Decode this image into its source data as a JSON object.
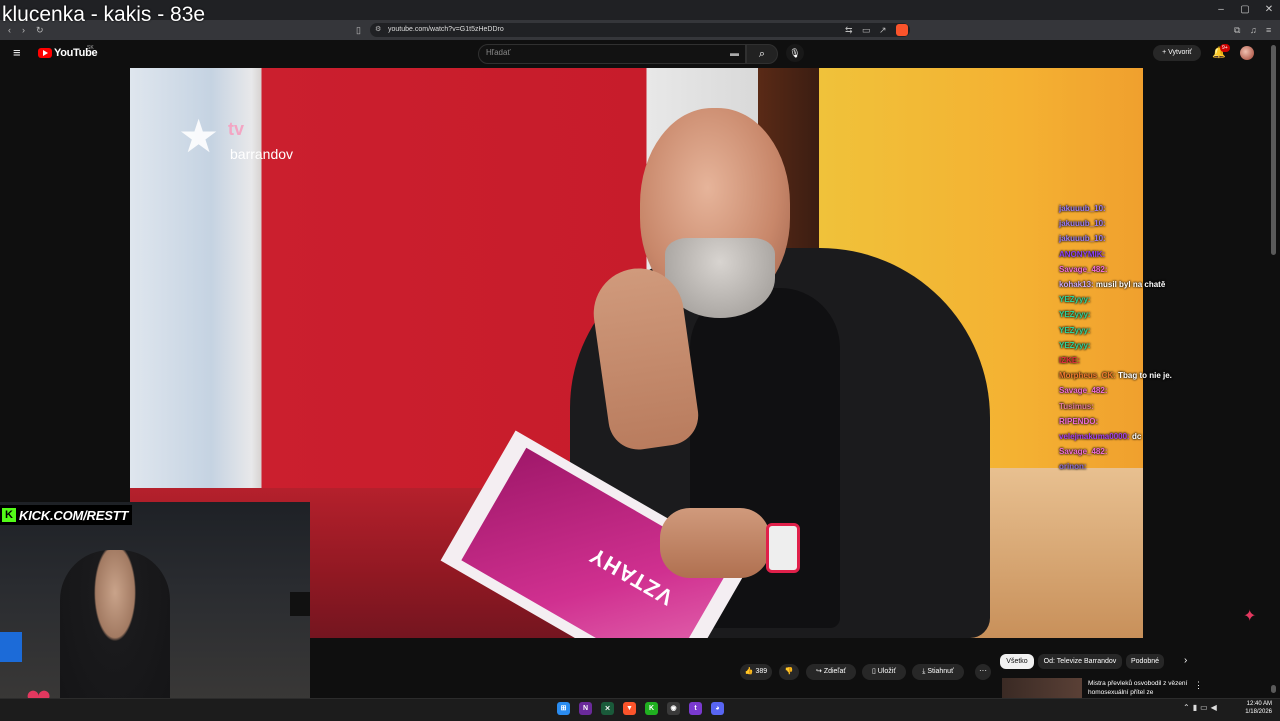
{
  "stream_overlay_title": "klucenka - kakis - 83e",
  "browser": {
    "url": "youtube.com/watch?v=G1t5zHeDDro",
    "window_controls": [
      "–",
      "▢",
      "✕"
    ]
  },
  "youtube_header": {
    "logo_text": "YouTube",
    "region": "SK",
    "search_placeholder": "Hľadať",
    "create_label": "Vytvoriť",
    "notification_count": "9+"
  },
  "video": {
    "channel_logo_tv": "tv",
    "channel_logo_name": "barrandov",
    "card_text": "VZTAHY"
  },
  "chat": [
    {
      "user": "jakuuub_10:",
      "msg": "",
      "color": "#9a7cf0"
    },
    {
      "user": "jakuuub_10:",
      "msg": "",
      "color": "#9a7cf0"
    },
    {
      "user": "jakuuub_10:",
      "msg": "",
      "color": "#9a7cf0"
    },
    {
      "user": "ANONYMIK:",
      "msg": "",
      "color": "#8a3ff0"
    },
    {
      "user": "Savage_482:",
      "msg": "",
      "color": "#f06cd8"
    },
    {
      "user": "kohak13:",
      "msg": "musil byl na chatě",
      "color": "#c9a7f5"
    },
    {
      "user": "YEZyyy:",
      "msg": "",
      "color": "#2fd39a"
    },
    {
      "user": "YEZyyy:",
      "msg": "",
      "color": "#2fd39a"
    },
    {
      "user": "YEZyyy:",
      "msg": "",
      "color": "#2fd39a"
    },
    {
      "user": "YEZyyy:",
      "msg": "",
      "color": "#2fd39a"
    },
    {
      "user": "IZKE:",
      "msg": "",
      "color": "#e02f3f"
    },
    {
      "user": "Morpheus_CK:",
      "msg": "Tbag to nie je.",
      "color": "#f07a2f"
    },
    {
      "user": "Savage_482:",
      "msg": "",
      "color": "#f06cd8"
    },
    {
      "user": "Tusimus:",
      "msg": "",
      "color": "#e07a9a"
    },
    {
      "user": "RIPENDO:",
      "msg": "",
      "color": "#f06cd8"
    },
    {
      "user": "velejmakuma0000:",
      "msg": "dc",
      "color": "#a63ff0"
    },
    {
      "user": "Savage_482:",
      "msg": "",
      "color": "#f06cd8"
    },
    {
      "user": "orinon:",
      "msg": "",
      "color": "#8a6cd8"
    }
  ],
  "webcam": {
    "kick_badge": "KICK.COM/RESTT"
  },
  "actions": {
    "like_count": "389",
    "share_label": "Zdieľať",
    "save_label": "Uložiť",
    "download_label": "Stiahnuť",
    "more_label": "···"
  },
  "chips": {
    "all": "Všetko",
    "from_channel": "Od: Televize Barrandov",
    "similar": "Podobné"
  },
  "recommendation": {
    "title": "Mistra převleků osvobodil z vězení homosexuální přítel ze"
  },
  "taskbar": {
    "time": "12:40 AM",
    "date": "1/18/2026"
  }
}
